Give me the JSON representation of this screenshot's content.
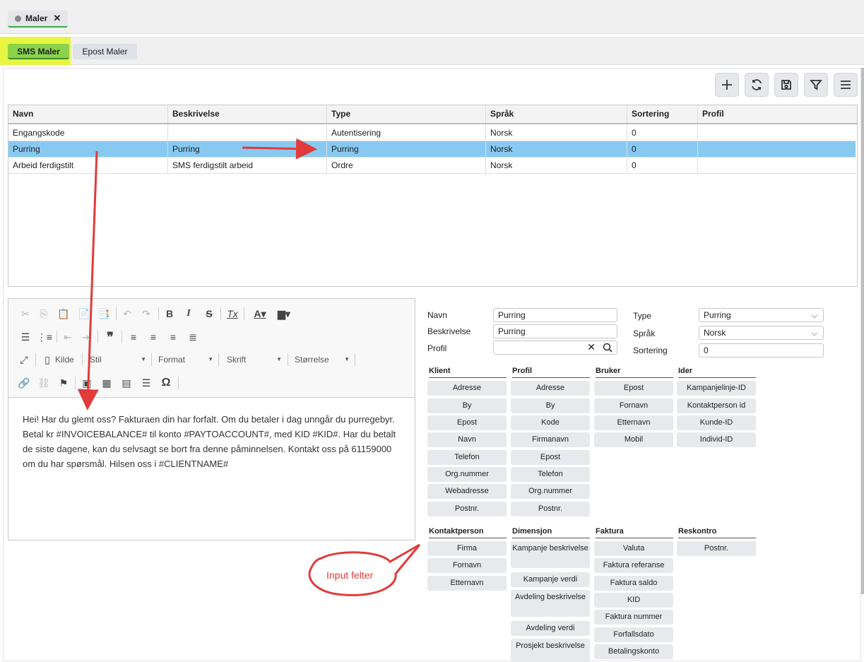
{
  "doc_tab": {
    "label": "Maler",
    "close": "✕"
  },
  "subtabs": {
    "sms": "SMS Maler",
    "epost": "Epost Maler"
  },
  "toolbar": {
    "add_icon": "plus-icon",
    "refresh_icon": "refresh-icon",
    "save_icon": "save-icon",
    "filter_icon": "filter-icon",
    "menu_icon": "menu-icon"
  },
  "grid": {
    "columns": [
      "Navn",
      "Beskrivelse",
      "Type",
      "Språk",
      "Sortering",
      "Profil"
    ],
    "rows": [
      [
        "Engangskode",
        "",
        "Autentisering",
        "Norsk",
        "0",
        ""
      ],
      [
        "Purring",
        "Purring",
        "Purring",
        "Norsk",
        "0",
        ""
      ],
      [
        "Arbeid ferdigstilt",
        "SMS ferdigstilt arbeid",
        "Ordre",
        "Norsk",
        "0",
        ""
      ]
    ],
    "selected_row": 1
  },
  "editor": {
    "combos": {
      "kilde": "Kilde",
      "stil": "Stil",
      "format": "Format",
      "skrift": "Skrift",
      "storrelse": "Størrelse"
    },
    "body": "Hei! Har du glemt oss? Fakturaen din har forfalt. Om du betaler i dag unngår du purregebyr. Betal kr #INVOICEBALANCE# til konto #PAYTOACCOUNT#, med KID #KID#. Har du betalt de siste dagene, kan du selvsagt se bort fra denne påminnelsen. Kontakt oss på 61159000 om du har spørsmål. Hilsen oss i #CLIENTNAME#"
  },
  "form": {
    "navn_label": "Navn",
    "navn_value": "Purring",
    "beskrivelse_label": "Beskrivelse",
    "beskrivelse_value": "Purring",
    "profil_label": "Profil",
    "profil_value": "",
    "type_label": "Type",
    "type_value": "Purring",
    "sprak_label": "Språk",
    "sprak_value": "Norsk",
    "sortering_label": "Sortering",
    "sortering_value": "0"
  },
  "groups": {
    "klient": {
      "title": "Klient",
      "items": [
        "Adresse",
        "By",
        "Epost",
        "Navn",
        "Telefon",
        "Org.nummer",
        "Webadresse",
        "Postnr."
      ]
    },
    "profil": {
      "title": "Profil",
      "items": [
        "Adresse",
        "By",
        "Kode",
        "Firmanavn",
        "Epost",
        "Telefon",
        "Org.nummer",
        "Postnr."
      ]
    },
    "bruker": {
      "title": "Bruker",
      "items": [
        "Epost",
        "Fornavn",
        "Etternavn",
        "Mobil"
      ]
    },
    "ider": {
      "title": "Ider",
      "items": [
        "Kampanjelinje-ID",
        "Kontaktperson id",
        "Kunde-ID",
        "Individ-ID"
      ]
    },
    "kontaktperson": {
      "title": "Kontaktperson",
      "items": [
        "Firma",
        "Fornavn",
        "Etternavn"
      ]
    },
    "dimensjon": {
      "title": "Dimensjon",
      "items": [
        "Kampanje beskrivelse",
        "Kampanje verdi",
        "Avdeling beskrivelse",
        "Avdeling verdi",
        "Prosjekt beskrivelse"
      ]
    },
    "faktura": {
      "title": "Faktura",
      "items": [
        "Valuta",
        "Faktura referanse",
        "Faktura saldo",
        "KID",
        "Faktura nummer",
        "Forfallsdato",
        "Betalingskonto"
      ]
    },
    "reskontro": {
      "title": "Reskontro",
      "items": [
        "Postnr."
      ]
    }
  },
  "annotation": {
    "callout": "Input felter",
    "color": "#e13b3b"
  }
}
